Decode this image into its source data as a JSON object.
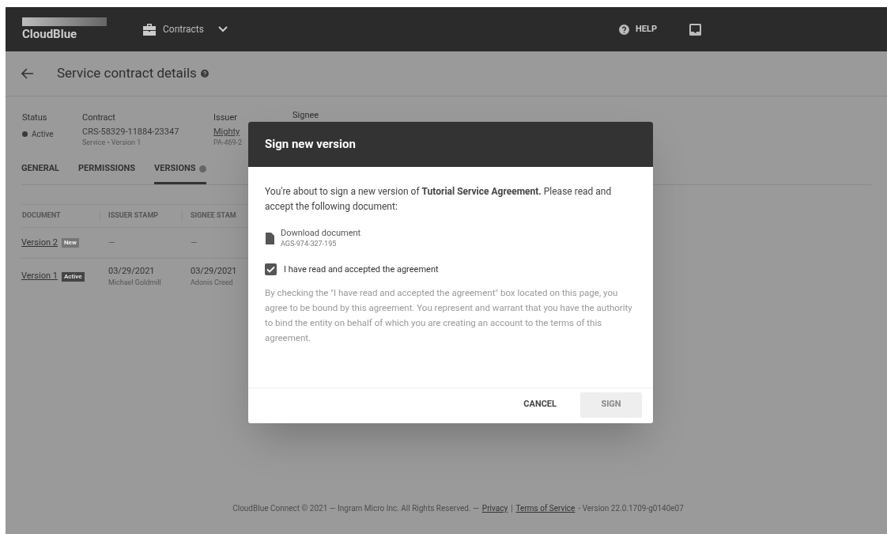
{
  "header": {
    "logo": "CloudBlue",
    "module": "Contracts",
    "help": "HELP"
  },
  "page": {
    "title": "Service contract details"
  },
  "summary": [
    {
      "label": "Status",
      "value": "Active"
    },
    {
      "label": "Contract",
      "value": "CRS-58329-11884-23347",
      "sub": "Service • Version 1"
    },
    {
      "label": "Issuer",
      "value": "Mighty",
      "sub": "PA-469-2",
      "link": true
    },
    {
      "label": "Signee"
    }
  ],
  "tabs": [
    {
      "label": "GENERAL",
      "selected": false
    },
    {
      "label": "PERMISSIONS",
      "selected": false
    },
    {
      "label": "VERSIONS",
      "selected": true
    }
  ],
  "table": {
    "columns": [
      "DOCUMENT",
      "ISSUER STAMP",
      "SIGNEE STAM"
    ],
    "rows": [
      {
        "document": "Version 2",
        "badge": "New",
        "current": false,
        "issuer": "—",
        "signee": "—"
      },
      {
        "document": "Version 1",
        "badge": "Active",
        "current": true,
        "issuer": "03/29/2021",
        "issuer_sub": "Michael Goldmill",
        "signee": "03/29/2021",
        "signee_sub": "Adonis Creed"
      }
    ]
  },
  "dialog": {
    "title": "Sign new version",
    "intro": "You're about to sign a new version of **Tutorial Service Agreement.** Please read and accept the following document:",
    "download": "Download document",
    "doc_id": "AGS-974-327-195",
    "checkbox": {
      "label": "I have read and accepted the agreement",
      "checked": true
    },
    "terms": "By checking the \"I have read and accepted the agreement\" box located on this page, you agree to be bound by this agreement. You represent and warrant that you have the authority to bind the entity on behalf of which you are creating an account to the terms of this agreement.",
    "cancel": "CANCEL",
    "sign": "SIGN"
  },
  "footer": {
    "text": "CloudBlue Connect © 2021 — Ingram Micro Inc. All Rights Reserved. —",
    "privacy": "Privacy",
    "sep": "|",
    "terms": "Terms of Service",
    "version": "- Version 22.0.1709-g0140e07"
  }
}
